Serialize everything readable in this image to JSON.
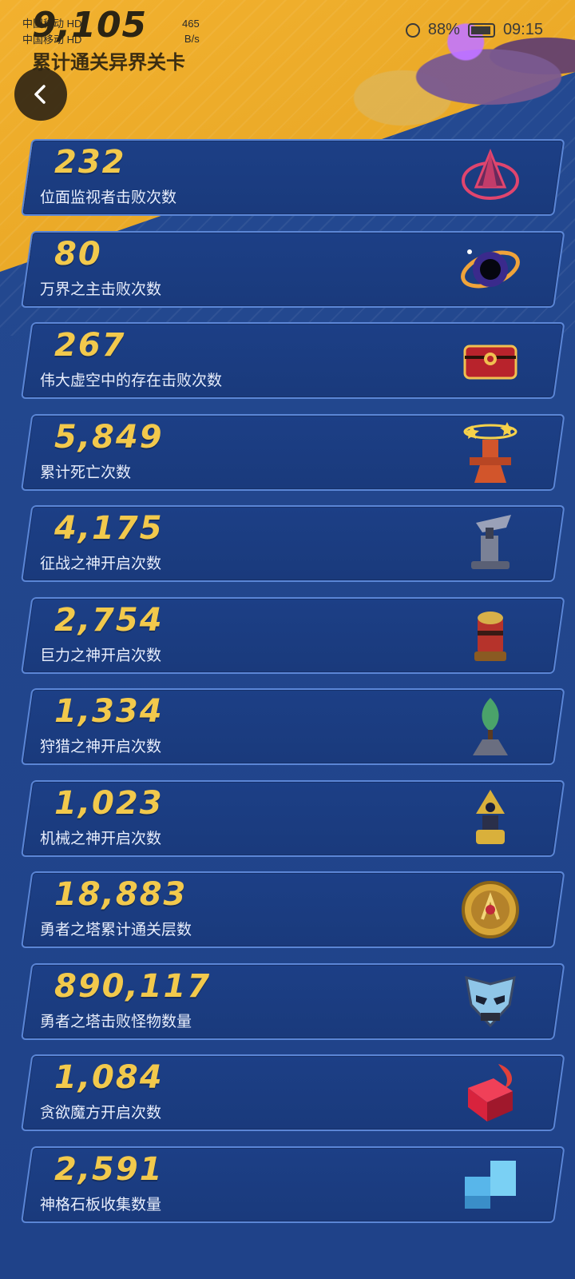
{
  "status_bar": {
    "carrier_1": "中国移动 HD",
    "carrier_2": "中国移动 HD",
    "net_speed_value": "465",
    "net_speed_unit": "B/s",
    "battery": "88%",
    "time": "09:15"
  },
  "header": {
    "top_number": "9,105",
    "subtitle": "累计通关异界关卡"
  },
  "back_button": {
    "icon": "chevron-left-icon"
  },
  "stats": [
    {
      "value": "232",
      "label": "位面监视者击败次数",
      "icon": "crystal-pyramid-icon",
      "icon_color": "#e0456e"
    },
    {
      "value": "80",
      "label": "万界之主击败次数",
      "icon": "black-hole-icon",
      "icon_color": "#f0a33a"
    },
    {
      "value": "267",
      "label": "伟大虚空中的存在击败次数",
      "icon": "red-chest-icon",
      "icon_color": "#b8232c"
    },
    {
      "value": "5,849",
      "label": "累计死亡次数",
      "icon": "dizzy-dummy-icon",
      "icon_color": "#d2552b"
    },
    {
      "value": "4,175",
      "label": "征战之神开启次数",
      "icon": "war-totem-icon",
      "icon_color": "#7a8196"
    },
    {
      "value": "2,754",
      "label": "巨力之神开启次数",
      "icon": "might-totem-icon",
      "icon_color": "#b6332b"
    },
    {
      "value": "1,334",
      "label": "狩猎之神开启次数",
      "icon": "hunt-totem-icon",
      "icon_color": "#4aa36a"
    },
    {
      "value": "1,023",
      "label": "机械之神开启次数",
      "icon": "machine-totem-icon",
      "icon_color": "#d9b03b"
    },
    {
      "value": "18,883",
      "label": "勇者之塔累计通关层数",
      "icon": "tower-medal-icon",
      "icon_color": "#d7a638"
    },
    {
      "value": "890,117",
      "label": "勇者之塔击败怪物数量",
      "icon": "monster-mask-icon",
      "icon_color": "#8fc6e8"
    },
    {
      "value": "1,084",
      "label": "贪欲魔方开启次数",
      "icon": "greed-cube-icon",
      "icon_color": "#d8233d"
    },
    {
      "value": "2,591",
      "label": "神格石板收集数量",
      "icon": "stone-tablet-icon",
      "icon_color": "#58b6ea"
    }
  ],
  "colors": {
    "value_gold": "#f2c94c",
    "card_border": "#5b86d6",
    "background_blue": "#21478f",
    "header_yellow": "#f2b12f"
  }
}
